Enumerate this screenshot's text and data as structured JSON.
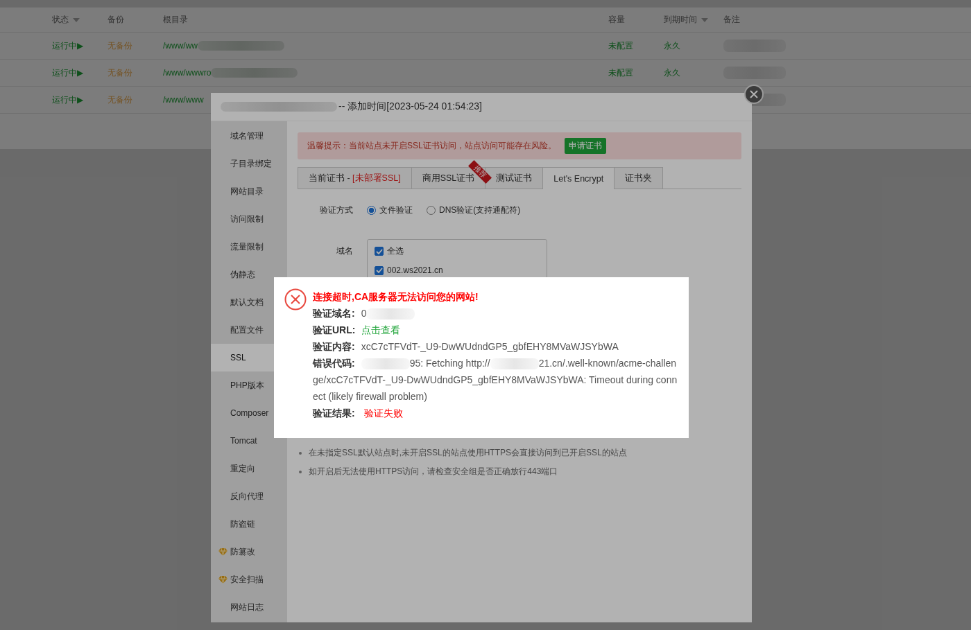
{
  "site_table": {
    "columns": [
      {
        "label": "状态",
        "sort": true
      },
      {
        "label": "备份",
        "sort": false
      },
      {
        "label": "根目录",
        "sort": false
      },
      {
        "label": "容量",
        "sort": false
      },
      {
        "label": "到期时间",
        "sort": true
      },
      {
        "label": "备注",
        "sort": false
      }
    ],
    "rows": [
      {
        "status": "运行中▶",
        "backup": "无备份",
        "root": "/www/ww",
        "root_redacted": true,
        "capacity": "未配置",
        "expiry": "永久",
        "remark_redacted": true
      },
      {
        "status": "运行中▶",
        "backup": "无备份",
        "root": "/www/wwwro",
        "root_redacted": true,
        "capacity": "未配置",
        "expiry": "永久",
        "remark_redacted": true
      },
      {
        "status": "运行中▶",
        "backup": "无备份",
        "root": "/www/www",
        "root_redacted": false,
        "remark_redacted": true
      }
    ]
  },
  "site_dialog": {
    "title_parts": [
      {
        "kind": "redacted"
      },
      {
        "kind": "text",
        "text": "-- 添加时间[2023-05-24 01:54:23]"
      }
    ],
    "menu": [
      {
        "label": "域名管理",
        "selected": false,
        "kind": "plain"
      },
      {
        "label": "子目录绑定",
        "selected": false,
        "kind": "plain"
      },
      {
        "label": "网站目录",
        "selected": false,
        "kind": "plain"
      },
      {
        "label": "访问限制",
        "selected": false,
        "kind": "plain"
      },
      {
        "label": "流量限制",
        "selected": false,
        "kind": "plain"
      },
      {
        "label": "伪静态",
        "selected": false,
        "kind": "plain"
      },
      {
        "label": "默认文档",
        "selected": false,
        "kind": "plain"
      },
      {
        "label": "配置文件",
        "selected": false,
        "kind": "plain"
      },
      {
        "label": "SSL",
        "selected": true,
        "kind": "plain"
      },
      {
        "label": "PHP版本",
        "selected": false,
        "kind": "plain"
      },
      {
        "label": "Composer",
        "selected": false,
        "kind": "plain"
      },
      {
        "label": "Tomcat",
        "selected": false,
        "kind": "plain"
      },
      {
        "label": "重定向",
        "selected": false,
        "kind": "plain"
      },
      {
        "label": "反向代理",
        "selected": false,
        "kind": "plain"
      },
      {
        "label": "防盗链",
        "selected": false,
        "kind": "plain"
      },
      {
        "label": "防篡改",
        "selected": false,
        "kind": "premium"
      },
      {
        "label": "安全扫描",
        "selected": false,
        "kind": "premium"
      },
      {
        "label": "网站日志",
        "selected": false,
        "kind": "plain"
      }
    ],
    "warning": {
      "text": "温馨提示：当前站点未开启SSL证书访问，站点访问可能存在风险。",
      "button": "申请证书"
    },
    "tabs": [
      {
        "label": "当前证书 - ",
        "status": "[未部署SSL]",
        "selected": false
      },
      {
        "label": "商用SSL证书",
        "badge": "推荐",
        "selected": false
      },
      {
        "label": "测试证书",
        "selected": false
      },
      {
        "label": "Let's Encrypt",
        "selected": true
      },
      {
        "label": "证书夹",
        "selected": false
      }
    ],
    "verify_method": {
      "label": "验证方式",
      "options": [
        {
          "label": "文件验证",
          "selected": true
        },
        {
          "label": "DNS验证(支持通配符)",
          "selected": false
        }
      ]
    },
    "domains": {
      "label": "域名",
      "items": [
        {
          "label": "全选",
          "checked": true
        },
        {
          "label": "002.ws2021.cn",
          "checked": true
        }
      ]
    },
    "notes": [
      "在未指定SSL默认站点时,未开启SSL的站点使用HTTPS会直接访问到已开启SSL的站点",
      "如开启后无法使用HTTPS访问，请检查安全组是否正确放行443端口"
    ]
  },
  "error_alert": {
    "title": "连接超时,CA服务器无法访问您的网站!",
    "fields": [
      {
        "label": "验证域名:",
        "parts": [
          {
            "kind": "text",
            "text": "0"
          },
          {
            "kind": "redacted"
          }
        ]
      },
      {
        "label": "验证URL:",
        "parts": [
          {
            "kind": "link",
            "text": "点击查看"
          }
        ]
      },
      {
        "label": "验证内容:",
        "parts": [
          {
            "kind": "text",
            "text": "xcC7cTFVdT-_U9-DwWUdndGP5_gbfEHY8MVaWJSYbWA"
          }
        ]
      },
      {
        "label": "错误代码:",
        "parts": [
          {
            "kind": "redacted"
          },
          {
            "kind": "text",
            "text": "95: Fetching http://"
          },
          {
            "kind": "redacted"
          },
          {
            "kind": "text",
            "text": "21.cn/.well-known/acme-challenge/xcC7cTFVdT-_U9-DwWUdndGP5_gbfEHY8MVaWJSYbWA: Timeout during connect (likely firewall problem)"
          }
        ]
      },
      {
        "label": "验证结果:",
        "parts": [
          {
            "kind": "error",
            "text": "验证失败"
          }
        ]
      }
    ]
  }
}
